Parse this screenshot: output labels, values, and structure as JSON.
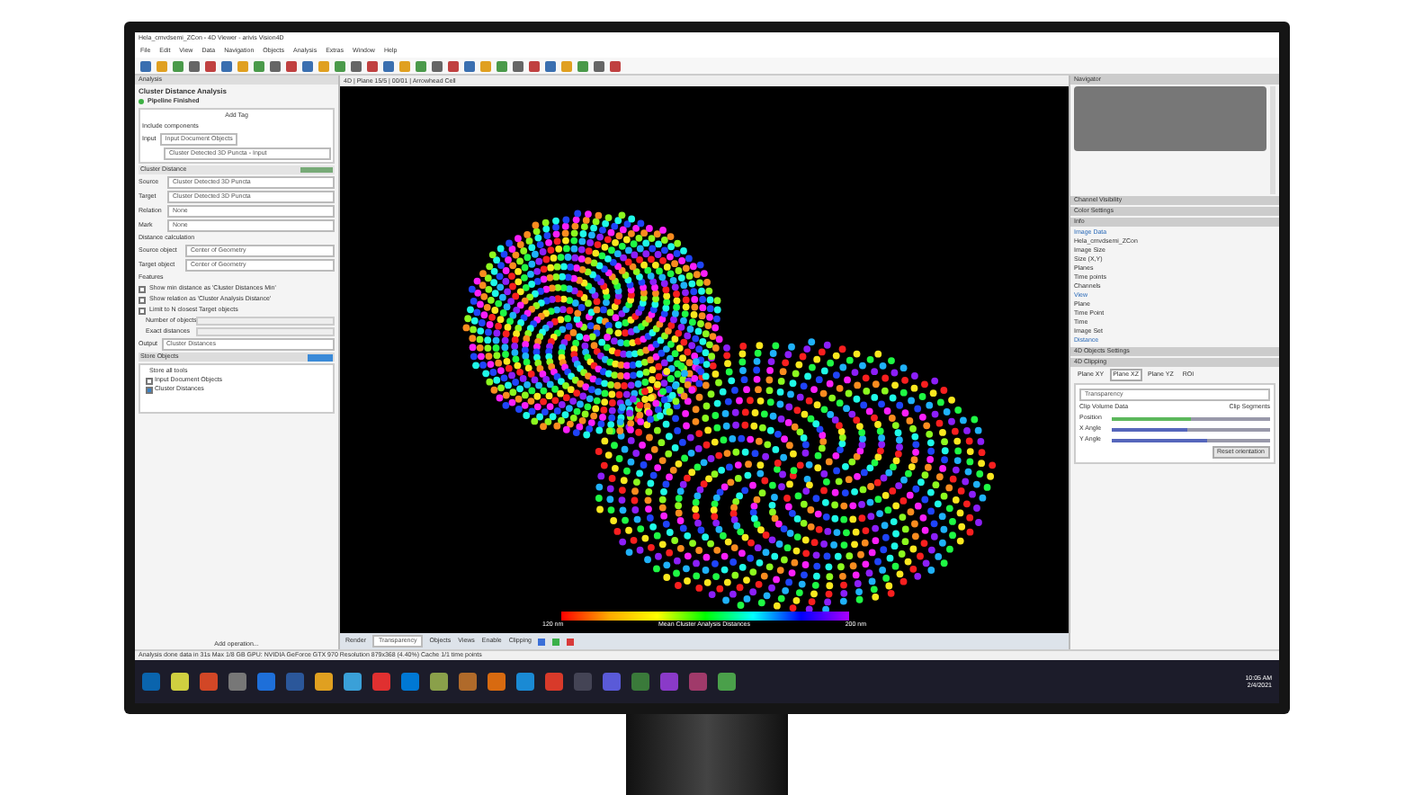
{
  "window": {
    "title": "Hela_cmvdsemi_ZCon - 4D Viewer - arivis Vision4D",
    "menu": [
      "File",
      "Edit",
      "View",
      "Data",
      "Navigation",
      "Objects",
      "Analysis",
      "Extras",
      "Window",
      "Help"
    ]
  },
  "analysis_panel": {
    "header": "Analysis",
    "title": "Cluster Distance Analysis",
    "status": "Pipeline Finished",
    "add_tag": "Add Tag",
    "include_components": "Include components",
    "input": {
      "label": "Input",
      "value": "Input Document Objects",
      "sub_value": "Cluster Detected 3D Puncta - Input"
    },
    "operation": {
      "title": "Cluster Distance",
      "fields": [
        {
          "label": "Source",
          "value": "Cluster Detected 3D Puncta"
        },
        {
          "label": "Target",
          "value": "Cluster Detected 3D Puncta"
        },
        {
          "label": "Relation",
          "value": "None"
        },
        {
          "label": "Mark",
          "value": "None"
        }
      ]
    },
    "distance_header": "Distance calculation",
    "distance_fields": [
      {
        "label": "Source object",
        "value": "Center of Geometry"
      },
      {
        "label": "Target object",
        "value": "Center of Geometry"
      }
    ],
    "features_header": "Features",
    "features": [
      {
        "label": "Show min distance as 'Cluster Distances Min'",
        "checked": false
      },
      {
        "label": "Show relation as 'Cluster Analysis Distance'",
        "checked": false
      },
      {
        "label": "Limit to N closest Target objects",
        "checked": false
      }
    ],
    "number_label": "Number of objects",
    "exact_label": "Exact distances",
    "output": {
      "label": "Output",
      "value": "Cluster Distances"
    },
    "store": {
      "title": "Store Objects",
      "all_label": "Store all tools",
      "tree": [
        {
          "label": "Input Document Objects",
          "checked": false
        },
        {
          "label": "Cluster Distances",
          "checked": true
        }
      ]
    },
    "add_operation": "Add operation..."
  },
  "viewer": {
    "header": "4D  |  Plane 15/5  |  00/01  |  Arrowhead Cell",
    "scale": {
      "min": "120 nm",
      "label": "Mean Cluster Analysis Distances",
      "max": "200 nm"
    },
    "toolbar": {
      "render_label": "Render",
      "render_value": "Transparency",
      "objects_label": "Objects",
      "views_label": "Views",
      "enable_label": "Enable",
      "clipping_label": "Clipping"
    }
  },
  "right_panel": {
    "navigator": "Navigator",
    "collapsed": [
      "Channel Visibility",
      "Color Settings"
    ],
    "info": "Info",
    "image_data": "Image Data",
    "file": "Hela_cmvdsemi_ZCon",
    "image_rows": [
      "Image Size",
      "Size (X,Y)",
      "Planes",
      "Time points",
      "Channels"
    ],
    "view": "View",
    "view_rows": [
      "Plane",
      "Time Point",
      "Time",
      "Image Set"
    ],
    "distance": "Distance",
    "objects_settings": "4D Objects Settings",
    "clipping": "4D Clipping",
    "tabs": [
      {
        "label": "Plane XY",
        "selected": false
      },
      {
        "label": "Plane XZ",
        "selected": true
      },
      {
        "label": "Plane YZ",
        "selected": false
      },
      {
        "label": "ROI",
        "selected": false
      }
    ],
    "mode": "Transparency",
    "volume_label": "Clip Volume Data",
    "segments_label": "Clip Segments",
    "sliders": [
      {
        "label": "Position",
        "level": 0.5
      },
      {
        "label": "X Angle",
        "level": 0.48
      },
      {
        "label": "Y Angle",
        "level": 0.6
      }
    ],
    "reset": "Reset orientation"
  },
  "status_bar": "Analysis done data in 31s   Max 1/8 GB   GPU: NVIDIA GeForce GTX 970   Resolution 879x368 (4.40%)   Cache 1/1 time points",
  "taskbar": {
    "time": "10:05 AM",
    "date": "2/4/2021"
  }
}
